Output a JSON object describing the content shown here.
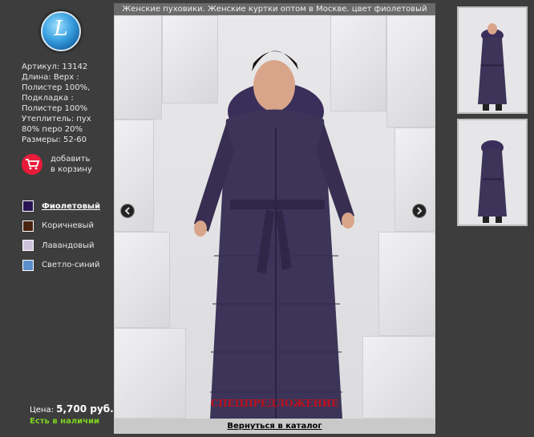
{
  "title": "Женские пуховики. Женские куртки оптом в Москве. цвет фиолетовый",
  "logo_text": "L",
  "specs": {
    "article": "Артикул: 13142",
    "length_top": "Длина: Верх :",
    "material_top": "Полистер 100%,",
    "lining": "Подкладка :",
    "material_lining": "Полистер 100%",
    "insulation": "Утеплитель: пух",
    "insulation2": "80% перо 20%",
    "sizes": "Размеры: 52-60"
  },
  "cart": {
    "line1": "добавить",
    "line2": "в корзину",
    "icon": "cart-icon"
  },
  "colors": [
    {
      "label": "Фиолетовый",
      "hex": "#2a1554",
      "active": true
    },
    {
      "label": "Коричневый",
      "hex": "#4a2410",
      "active": false
    },
    {
      "label": "Лавандовый",
      "hex": "#cfc3dc",
      "active": false
    },
    {
      "label": "Светло-синий",
      "hex": "#5a8fcc",
      "active": false
    }
  ],
  "price": {
    "label": "Цена:",
    "value": "5,700 руб."
  },
  "stock": "Есть в наличии",
  "special": "СПЕЦПРЕДЛОЖЕНИЕ",
  "back_link": "Вернуться в каталог",
  "coat_color": "#3d3459"
}
